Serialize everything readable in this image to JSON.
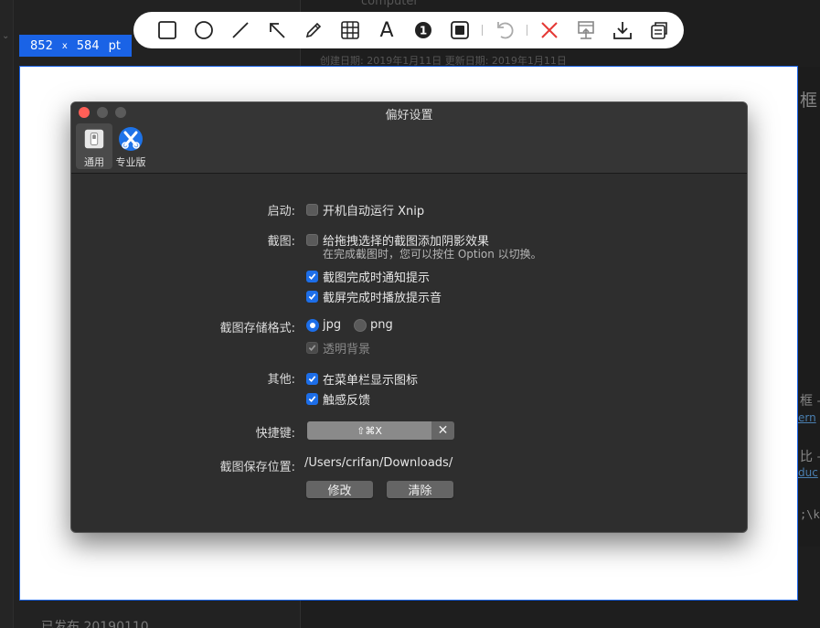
{
  "background": {
    "window_title": "computer",
    "meta_text": "创建日期: 2019年1月11日    更新日期: 2019年1月11日",
    "published_text": "已发布 20190110",
    "right_fragments": [
      "框",
      "框 –",
      "比 –"
    ],
    "right_links": [
      "ern",
      "duc"
    ],
    "right_code": ";\\k"
  },
  "toolbar": {
    "tools": [
      {
        "name": "rectangle-tool-icon"
      },
      {
        "name": "ellipse-tool-icon"
      },
      {
        "name": "line-tool-icon"
      },
      {
        "name": "arrow-tool-icon"
      },
      {
        "name": "pencil-tool-icon"
      },
      {
        "name": "mosaic-tool-icon"
      },
      {
        "name": "text-tool-icon",
        "glyph": "A"
      },
      {
        "name": "number-marker-tool-icon",
        "glyph": "1"
      },
      {
        "name": "highlight-tool-icon"
      },
      {
        "name": "undo-icon"
      },
      {
        "name": "cancel-icon"
      },
      {
        "name": "pin-icon"
      },
      {
        "name": "download-icon"
      },
      {
        "name": "copy-icon"
      }
    ],
    "accent_cancel": "#e53935"
  },
  "capture": {
    "width": "852",
    "x": "x",
    "height": "584",
    "unit": "pt",
    "accent": "#1a63e6"
  },
  "window": {
    "title": "偏好设置",
    "tabs": [
      {
        "label": "通用",
        "selected": true
      },
      {
        "label": "专业版",
        "selected": false
      }
    ]
  },
  "prefs": {
    "startup": {
      "label": "启动:",
      "auto_launch": {
        "text": "开机自动运行 Xnip",
        "checked": false
      }
    },
    "capture": {
      "label": "截图:",
      "shadow": {
        "text": "给拖拽选择的截图添加阴影效果",
        "checked": false
      },
      "shadow_hint": "在完成截图时，您可以按住 Option 以切换。",
      "notify": {
        "text": "截图完成时通知提示",
        "checked": true
      },
      "sound": {
        "text": "截屏完成时播放提示音",
        "checked": true
      }
    },
    "format": {
      "label": "截图存储格式:",
      "jpg": {
        "text": "jpg",
        "selected": true
      },
      "png": {
        "text": "png",
        "selected": false
      },
      "transparent": {
        "text": "透明背景",
        "checked": true,
        "disabled": true
      }
    },
    "other": {
      "label": "其他:",
      "menubar_icon": {
        "text": "在菜单栏显示图标",
        "checked": true
      },
      "haptic": {
        "text": "触感反馈",
        "checked": true
      }
    },
    "shortcut": {
      "label": "快捷键:",
      "value": "⇧⌘X",
      "clear": "✕"
    },
    "save_location": {
      "label": "截图保存位置:",
      "path": "/Users/crifan/Downloads/",
      "modify_label": "修改",
      "clear_label": "清除"
    }
  }
}
